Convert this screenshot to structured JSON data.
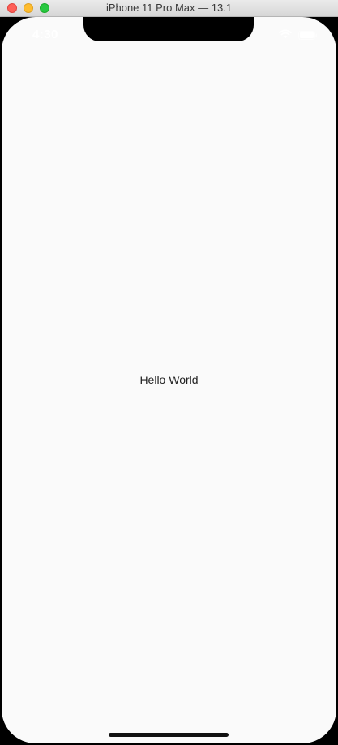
{
  "window": {
    "title": "iPhone 11 Pro Max — 13.1"
  },
  "status_bar": {
    "time": "4:30",
    "icons": [
      "wifi-icon",
      "battery-icon"
    ]
  },
  "main": {
    "text": "Hello World"
  },
  "colors": {
    "screen_background": "#fafafa",
    "text": "#222222",
    "close": "#fe5f57",
    "minimize": "#febc2e",
    "maximize": "#28c840"
  }
}
